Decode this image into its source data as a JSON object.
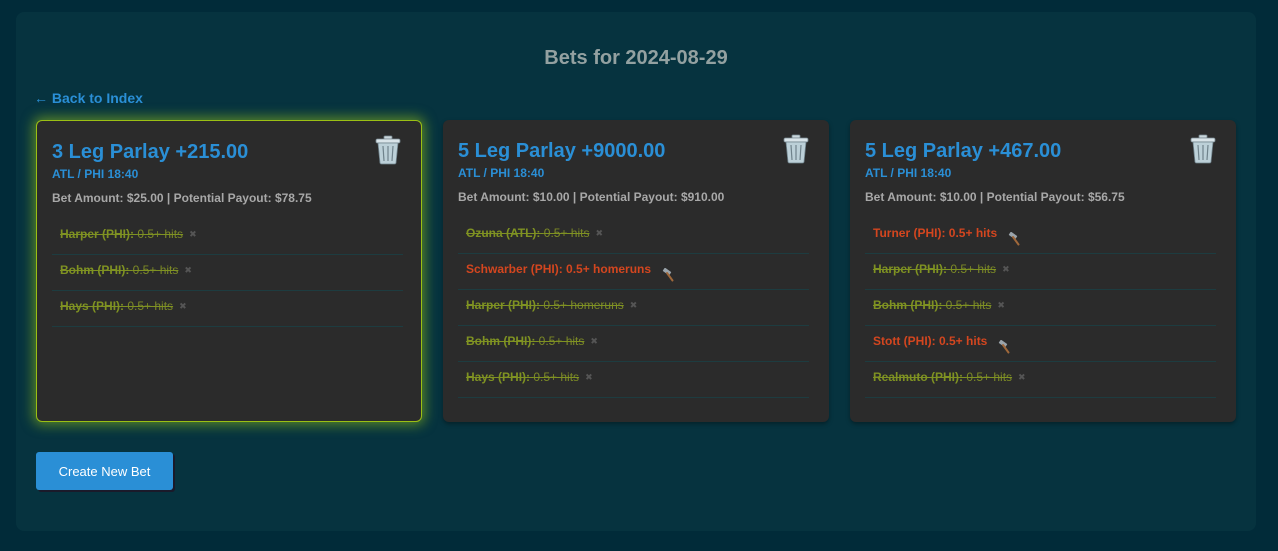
{
  "page": {
    "title": "Bets for 2024-08-29",
    "back_link": "← Back to Index",
    "create_button": "Create New Bet"
  },
  "colors": {
    "accent": "#2a8fd6",
    "won": "#7f9222",
    "pending": "#d4461f",
    "active_glow": "#9bbf14"
  },
  "bets": [
    {
      "title": "3 Leg Parlay +215.00",
      "game": "ATL / PHI 18:40",
      "amount": "Bet Amount: $25.00 | Potential Payout: $78.75",
      "highlighted": true,
      "legs": [
        {
          "player": "Harper (PHI):",
          "detail": "0.5+ hits",
          "status": "won",
          "icon": "x-mark-icon"
        },
        {
          "player": "Bohm (PHI):",
          "detail": "0.5+ hits",
          "status": "won",
          "icon": "x-mark-icon"
        },
        {
          "player": "Hays (PHI):",
          "detail": "0.5+ hits",
          "status": "won",
          "icon": "x-mark-icon"
        }
      ]
    },
    {
      "title": "5 Leg Parlay +9000.00",
      "game": "ATL / PHI 18:40",
      "amount": "Bet Amount: $10.00 | Potential Payout: $910.00",
      "highlighted": false,
      "legs": [
        {
          "player": "Ozuna (ATL):",
          "detail": "0.5+ hits",
          "status": "won",
          "icon": "x-mark-icon"
        },
        {
          "player": "Schwarber (PHI):",
          "detail": "0.5+ homeruns",
          "status": "pending",
          "icon": "hammer-icon"
        },
        {
          "player": "Harper (PHI):",
          "detail": "0.5+ homeruns",
          "status": "won",
          "icon": "x-mark-icon"
        },
        {
          "player": "Bohm (PHI):",
          "detail": "0.5+ hits",
          "status": "won",
          "icon": "x-mark-icon"
        },
        {
          "player": "Hays (PHI):",
          "detail": "0.5+ hits",
          "status": "won",
          "icon": "x-mark-icon"
        }
      ]
    },
    {
      "title": "5 Leg Parlay +467.00",
      "game": "ATL / PHI 18:40",
      "amount": "Bet Amount: $10.00 | Potential Payout: $56.75",
      "highlighted": false,
      "legs": [
        {
          "player": "Turner (PHI):",
          "detail": "0.5+ hits",
          "status": "pending",
          "icon": "hammer-icon"
        },
        {
          "player": "Harper (PHI):",
          "detail": "0.5+ hits",
          "status": "won",
          "icon": "x-mark-icon"
        },
        {
          "player": "Bohm (PHI):",
          "detail": "0.5+ hits",
          "status": "won",
          "icon": "x-mark-icon"
        },
        {
          "player": "Stott (PHI):",
          "detail": "0.5+ hits",
          "status": "pending",
          "icon": "hammer-icon"
        },
        {
          "player": "Realmuto (PHI):",
          "detail": "0.5+ hits",
          "status": "won",
          "icon": "x-mark-icon"
        }
      ]
    }
  ]
}
